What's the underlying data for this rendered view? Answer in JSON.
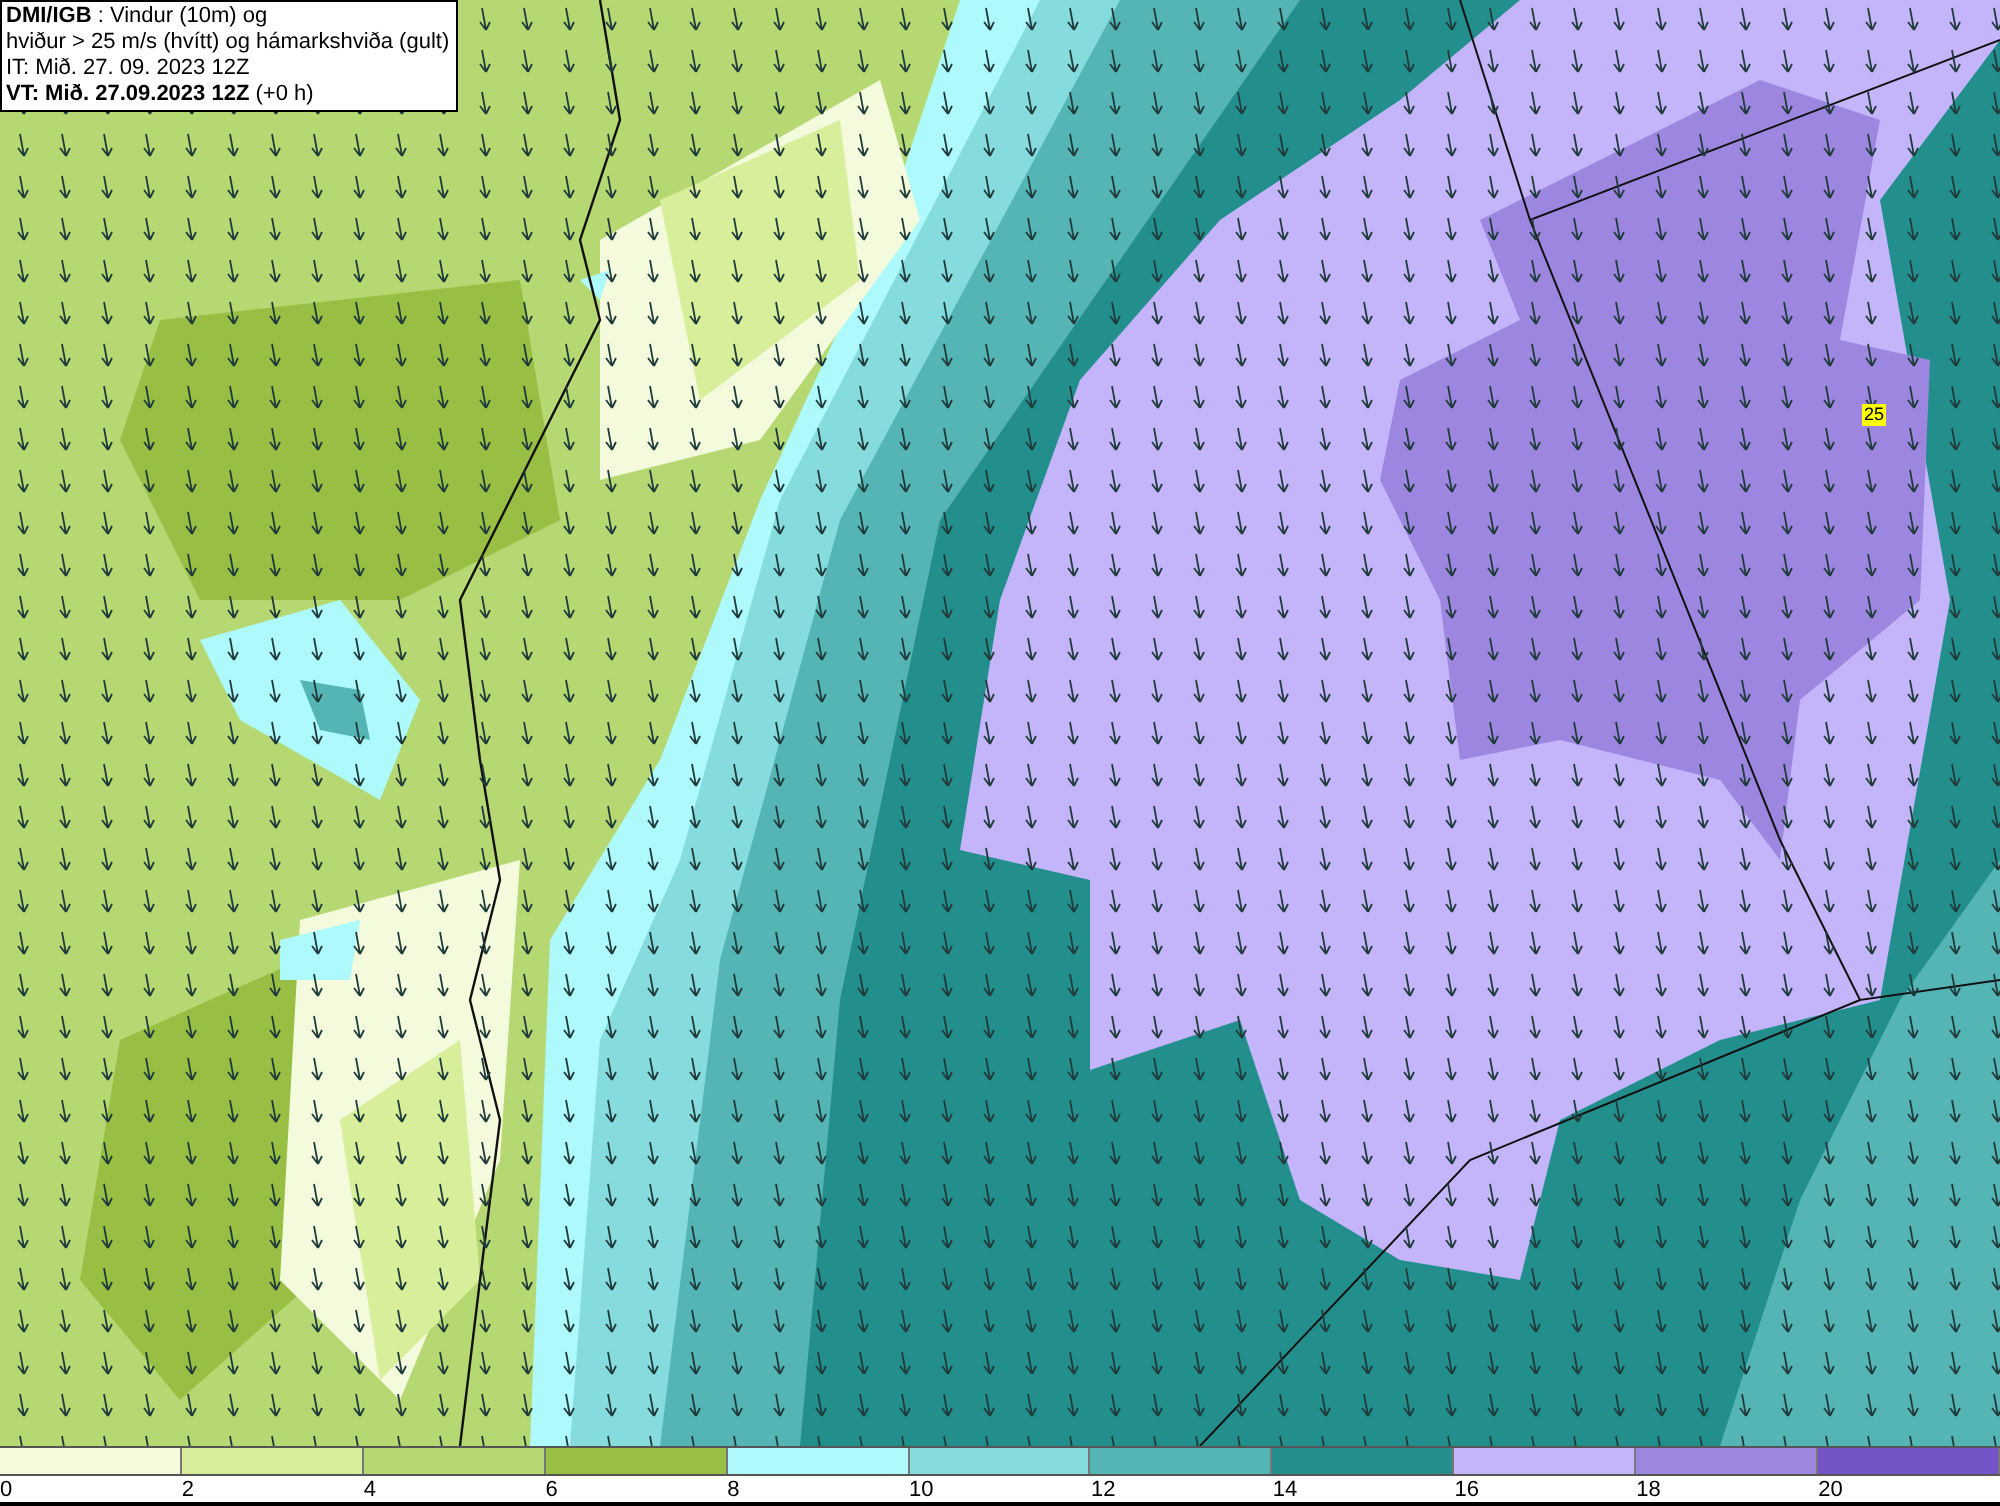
{
  "header": {
    "lines": [
      "**DMI/IGB** : Vindur (10m) og",
      "hviður > 25 m/s (hvítt) og hámarkshviða (gult)",
      "IT: Mið. 27. 09. 2023 12Z",
      "**VT: Mið. 27.09.2023 12Z** (+0 h)"
    ]
  },
  "gust_marker": {
    "label": "25"
  },
  "legend": {
    "bands": [
      {
        "color": "#f4fadc",
        "label": "0"
      },
      {
        "color": "#d7ee9a",
        "label": "2"
      },
      {
        "color": "#b6d872",
        "label": "4"
      },
      {
        "color": "#98bf44",
        "label": "6"
      },
      {
        "color": "#aef9fb",
        "label": "8"
      },
      {
        "color": "#86dbdc",
        "label": "10"
      },
      {
        "color": "#55b5b5",
        "label": "12"
      },
      {
        "color": "#238f8c",
        "label": "14"
      },
      {
        "color": "#c4b5fb",
        "label": "16"
      },
      {
        "color": "#9c86e0",
        "label": "18"
      },
      {
        "color": "#7353c5",
        "label": "20"
      }
    ]
  }
}
